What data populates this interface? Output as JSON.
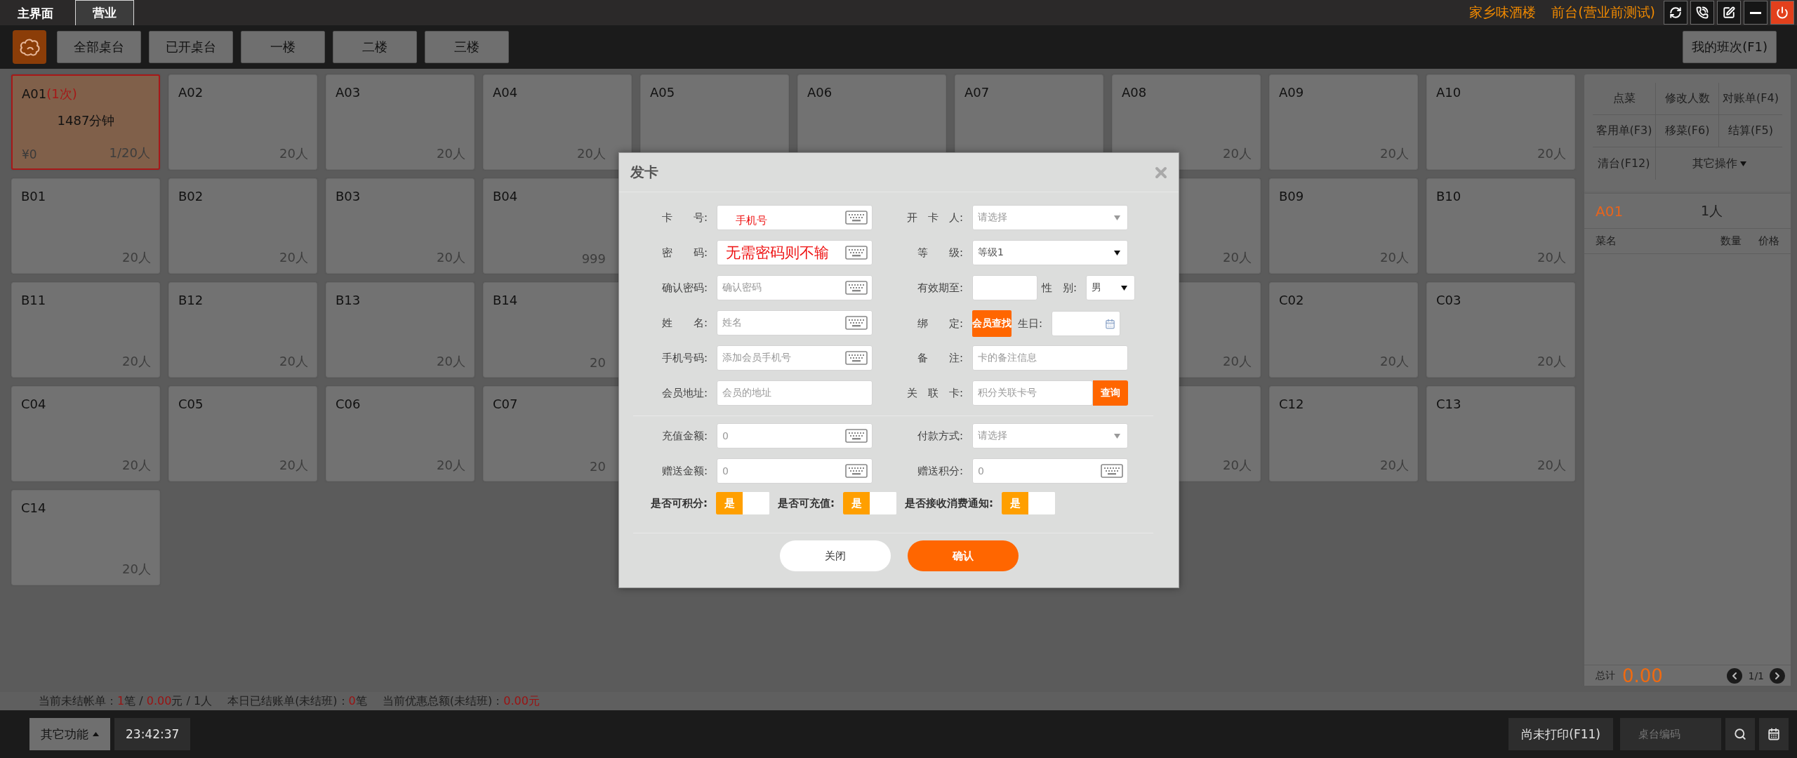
{
  "top_bar": {
    "tabs": [
      {
        "label": "主界面",
        "selected": false
      },
      {
        "label": "营业",
        "selected": true
      }
    ],
    "shop_name": "家乡味酒楼",
    "terminal": "前台(营业前测试)"
  },
  "toolbar": {
    "filters": [
      "全部桌台",
      "已开桌台",
      "一楼",
      "二楼",
      "三楼"
    ],
    "shift_button": "我的班次(F1)"
  },
  "tables": [
    {
      "left": [
        {
          "name": "A01",
          "visits": "(1次)",
          "duration": "1487分钟",
          "amount": "¥0",
          "count": "1/20人",
          "selected": true
        },
        {
          "name": "A02",
          "count": "20人",
          "selected": false
        },
        {
          "name": "A03",
          "count": "20人",
          "selected": false
        },
        {
          "name": "A04",
          "count": "20人",
          "selected": false
        },
        {
          "name": "A05",
          "selected": false
        },
        {
          "name": "A06",
          "selected": false
        },
        {
          "name": "A07",
          "selected": false
        },
        {
          "name": "A08",
          "count": "20人",
          "selected": false
        },
        {
          "name": "A09",
          "count": "20人",
          "selected": false
        },
        {
          "name": "A10",
          "count": "20人",
          "selected": false
        }
      ]
    },
    {
      "left": [
        {
          "name": "B01",
          "count": "20人",
          "selected": false
        },
        {
          "name": "B02",
          "count": "20人",
          "selected": false
        },
        {
          "name": "B03",
          "count": "20人",
          "selected": false
        },
        {
          "name": "B04",
          "count": "999",
          "selected": false
        }
      ],
      "right": [
        {
          "count": "20人",
          "selected": false
        },
        {
          "name": "B09",
          "count": "20人",
          "selected": false
        },
        {
          "name": "B10",
          "count": "20人",
          "selected": false
        }
      ]
    },
    {
      "left": [
        {
          "name": "B11",
          "count": "20人",
          "selected": false
        },
        {
          "name": "B12",
          "count": "20人",
          "selected": false
        },
        {
          "name": "B13",
          "count": "20人",
          "selected": false
        },
        {
          "name": "B14",
          "count": "20",
          "selected": false
        }
      ],
      "right": [
        {
          "count": "20人",
          "selected": false
        },
        {
          "name": "C02",
          "count": "20人",
          "selected": false
        },
        {
          "name": "C03",
          "count": "20人",
          "selected": false
        }
      ]
    },
    {
      "left": [
        {
          "name": "C04",
          "count": "20人",
          "selected": false
        },
        {
          "name": "C05",
          "count": "20人",
          "selected": false
        },
        {
          "name": "C06",
          "count": "20人",
          "selected": false
        },
        {
          "name": "C07",
          "count": "20",
          "selected": false
        }
      ],
      "right": [
        {
          "count": "20人",
          "selected": false
        },
        {
          "name": "C12",
          "count": "20人",
          "selected": false
        },
        {
          "name": "C13",
          "count": "20人",
          "selected": false
        }
      ]
    },
    {
      "left": [
        {
          "name": "C14",
          "count": "20人",
          "selected": false
        }
      ]
    }
  ],
  "side_panel": {
    "actions": [
      {
        "label": "点菜"
      },
      {
        "label": "修改人数"
      },
      {
        "label": "对账单(F4)"
      },
      {
        "label": "客用单(F3)"
      },
      {
        "label": "移菜(F6)"
      },
      {
        "label": "结算(F5)"
      },
      {
        "label": "清台(F12)"
      },
      {
        "label": "其它操作",
        "dropdown": true
      }
    ],
    "order": {
      "table": "A01",
      "guests": "1人",
      "columns": [
        "菜名",
        "数量",
        "价格"
      ],
      "total_label": "总计",
      "total": "0.00",
      "page": "1/1"
    }
  },
  "status_line": [
    [
      {
        "text": "当前未结帐单：",
        "highlight": false
      },
      {
        "text": "1",
        "highlight": true
      },
      {
        "text": "笔 / ",
        "highlight": false
      },
      {
        "text": "0.00",
        "highlight": true
      },
      {
        "text": "元 / 1人",
        "highlight": false
      }
    ],
    [
      {
        "text": "本日已结账单(未结班)：",
        "highlight": false
      },
      {
        "text": "0",
        "highlight": true
      },
      {
        "text": "笔",
        "highlight": false
      }
    ],
    [
      {
        "text": "当前优惠总额(未结班)：",
        "highlight": false
      },
      {
        "text": "0.00元",
        "highlight": true
      }
    ]
  ],
  "bottom_bar": {
    "more_button": "其它功能",
    "clock": "23:42:37",
    "unprinted_button": "尚未打印(F11)",
    "search": {
      "placeholder": "桌台编码"
    }
  },
  "dialog": {
    "title": "发卡",
    "left_fields": [
      {
        "kind": "keyboard",
        "label": "卡　　号:",
        "annotation": "手机号",
        "emphasis": false
      },
      {
        "kind": "keyboard",
        "label": "密　　码:",
        "annotation": "无需密码则不输",
        "emphasis": true
      },
      {
        "kind": "keyboard",
        "label": "确认密码:",
        "placeholder": "确认密码"
      },
      {
        "kind": "keyboard",
        "label": "姓　　名:",
        "placeholder": "姓名"
      },
      {
        "kind": "keyboard",
        "label": "手机号码:",
        "placeholder": "添加会员手机号"
      },
      {
        "kind": "text",
        "label": "会员地址:",
        "placeholder": "会员的地址"
      }
    ],
    "right_fields": [
      {
        "kind": "select",
        "label": "开　卡　人:",
        "placeholder": "请选择"
      },
      {
        "kind": "select",
        "label": "等　　级:",
        "value": "等级1"
      },
      {
        "kind": "date_gender",
        "label": "有效期至:",
        "gender_label": "性　别:",
        "gender": "男"
      },
      {
        "kind": "bind_birthday",
        "label": "绑　　定:",
        "button": "会员查找",
        "birthday_label": "生日:"
      },
      {
        "kind": "text",
        "label": "备　　注:",
        "placeholder": "卡的备注信息"
      },
      {
        "kind": "lookup",
        "label": "关　联　卡:",
        "placeholder": "积分关联卡号",
        "button": "查询"
      }
    ],
    "payment_left": [
      {
        "kind": "keyboard",
        "label": "充值金额:",
        "placeholder": "0"
      },
      {
        "kind": "keyboard",
        "label": "赠送金额:",
        "placeholder": "0"
      }
    ],
    "payment_right": [
      {
        "kind": "select",
        "label": "付款方式:",
        "placeholder": "请选择"
      },
      {
        "kind": "keyboard",
        "label": "赠送积分:",
        "placeholder": "0"
      }
    ],
    "toggles": [
      {
        "label": "是否可积分:",
        "on_label": "是",
        "on": true
      },
      {
        "label": "是否可充值:",
        "on_label": "是",
        "on": true
      },
      {
        "label": "是否接收消费通知:",
        "on_label": "是",
        "on": true
      }
    ],
    "buttons": [
      {
        "label": "关闭",
        "kind": "secondary"
      },
      {
        "label": "确认",
        "kind": "primary"
      }
    ]
  }
}
